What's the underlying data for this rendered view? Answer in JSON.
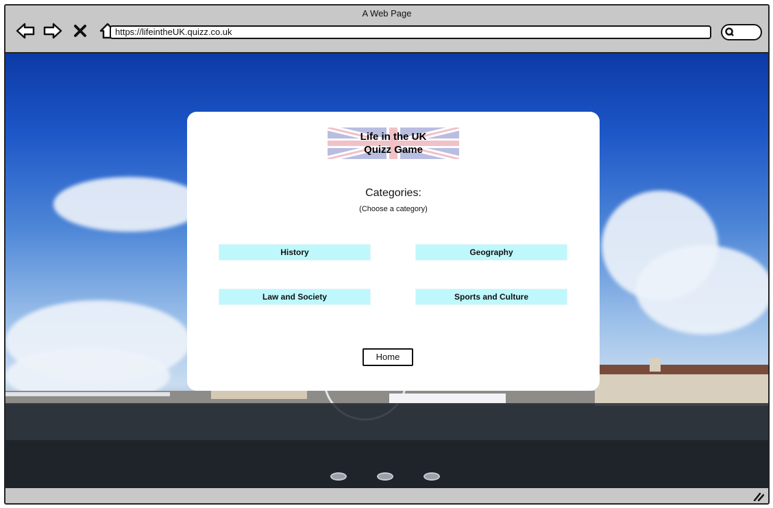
{
  "window": {
    "title": "A Web Page"
  },
  "browser": {
    "url": "https://lifeintheUK.quizz.co.uk",
    "icons": [
      "back-arrow-icon",
      "forward-arrow-icon",
      "close-icon",
      "home-icon",
      "search-icon",
      "resize-handle-icon"
    ]
  },
  "logo": {
    "line1": "Life in the UK",
    "line2": "Quizz Game"
  },
  "categories": {
    "title": "Categories:",
    "subtitle": "(Choose a category)",
    "items": [
      {
        "label": "History"
      },
      {
        "label": "Geography"
      },
      {
        "label": "Law and Society"
      },
      {
        "label": "Sports and Culture"
      }
    ]
  },
  "home_button": {
    "label": "Home"
  },
  "carousel": {
    "dot_count": 3
  },
  "colors": {
    "button_bg": "#bff8fc",
    "chrome": "#c8c8c8",
    "sky": "#1c56c7"
  }
}
